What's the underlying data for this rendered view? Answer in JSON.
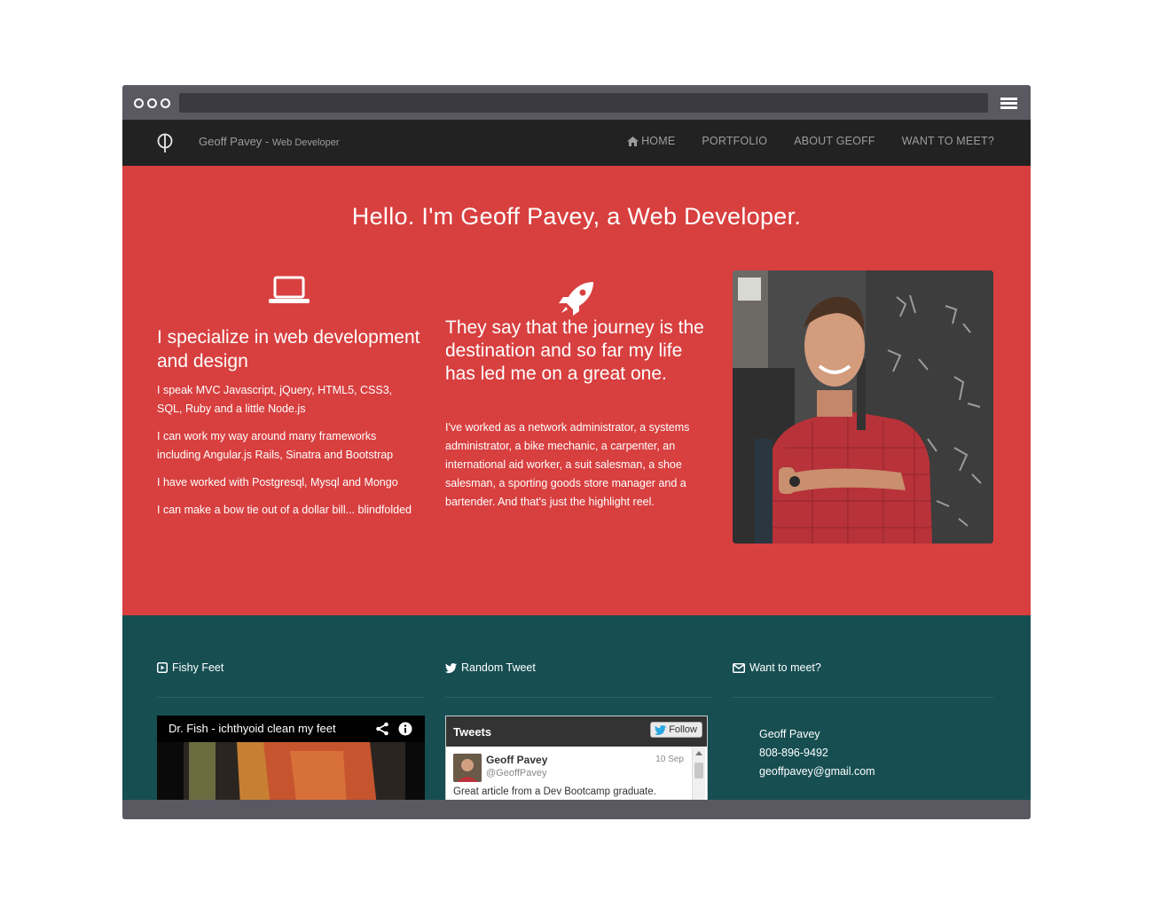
{
  "navbar": {
    "brand_name": "Geoff Pavey -",
    "brand_subtitle": "Web Developer",
    "items": [
      {
        "label": "HOME",
        "icon": "home-icon"
      },
      {
        "label": "PORTFOLIO"
      },
      {
        "label": "ABOUT GEOFF"
      },
      {
        "label": "WANT TO MEET?"
      }
    ]
  },
  "hero": {
    "title": "Hello. I'm Geoff Pavey, a Web Developer.",
    "col1": {
      "icon": "laptop-icon",
      "heading": "I specialize in web development and design",
      "paragraphs": [
        "I speak MVC Javascript, jQuery, HTML5, CSS3, SQL, Ruby and a little Node.js",
        "I can work my way around many frameworks including Angular.js Rails, Sinatra and Bootstrap",
        "I have worked with Postgresql, Mysql and Mongo",
        "I can make a bow tie out of a dollar bill... blindfolded"
      ]
    },
    "col2": {
      "icon": "rocket-icon",
      "heading": "They say that the journey is the destination and so far my life has led me on a great one.",
      "paragraph": "I've worked as a network administrator, a systems administrator, a bike mechanic, a carpenter, an international aid worker, a suit salesman, a shoe salesman, a sporting goods store manager and a bartender. And that's just the highlight reel."
    }
  },
  "footer": {
    "col1": {
      "icon": "play-icon",
      "heading": "Fishy Feet",
      "video_title": "Dr. Fish - ichthyoid clean my feet"
    },
    "col2": {
      "icon": "twitter-icon",
      "heading": "Random Tweet",
      "widget_title": "Tweets",
      "follow_label": "Follow",
      "tweet": {
        "name": "Geoff Pavey",
        "handle": "@GeoffPavey",
        "date": "10 Sep",
        "text": "Great article from a Dev Bootcamp graduate."
      }
    },
    "col3": {
      "icon": "envelope-icon",
      "heading": "Want to meet?",
      "name": "Geoff Pavey",
      "phone": "808-896-9492",
      "email": "geoffpavey@gmail.com"
    }
  },
  "colors": {
    "hero_bg": "#d83f3f",
    "footer_bg": "#164e52",
    "navbar_bg": "#222222",
    "frame": "#5a5961"
  }
}
